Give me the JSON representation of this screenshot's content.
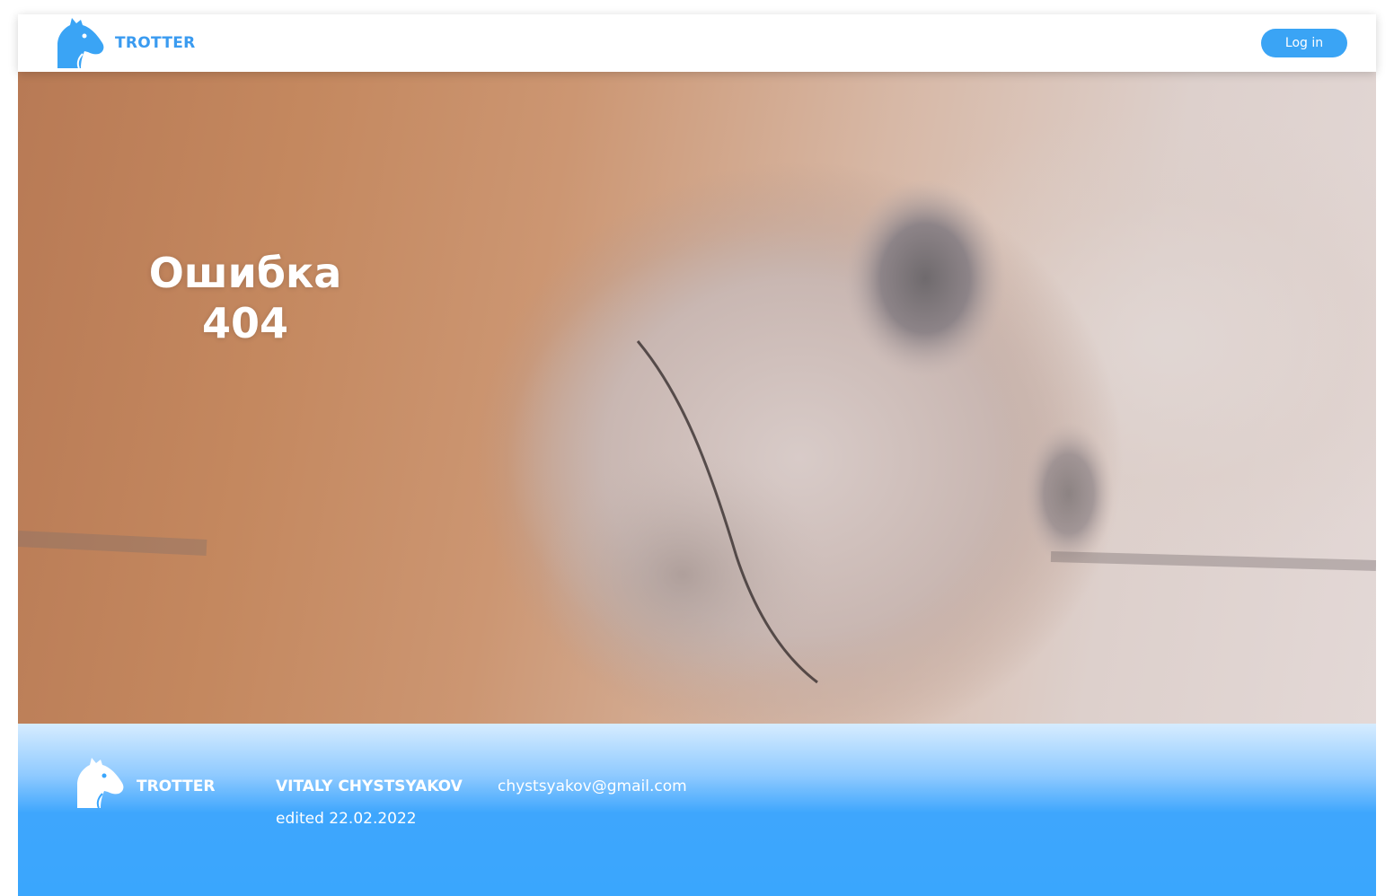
{
  "header": {
    "brand": "TROTTER",
    "login_label": "Log in",
    "logo_icon": "horse-head-icon"
  },
  "hero": {
    "title_line1": "Ошибка",
    "title_line2": "404",
    "background": "horse-nose-photo"
  },
  "footer": {
    "brand": "TROTTER",
    "author": "VITALY CHYSTSYAKOV",
    "email": "chystsyakov@gmail.com",
    "edited": "edited 22.02.2022",
    "logo_icon": "horse-head-icon"
  },
  "colors": {
    "accent": "#3aa4f5",
    "brand_text": "#3a9bf0",
    "footer_blue": "#3aa6fd"
  }
}
